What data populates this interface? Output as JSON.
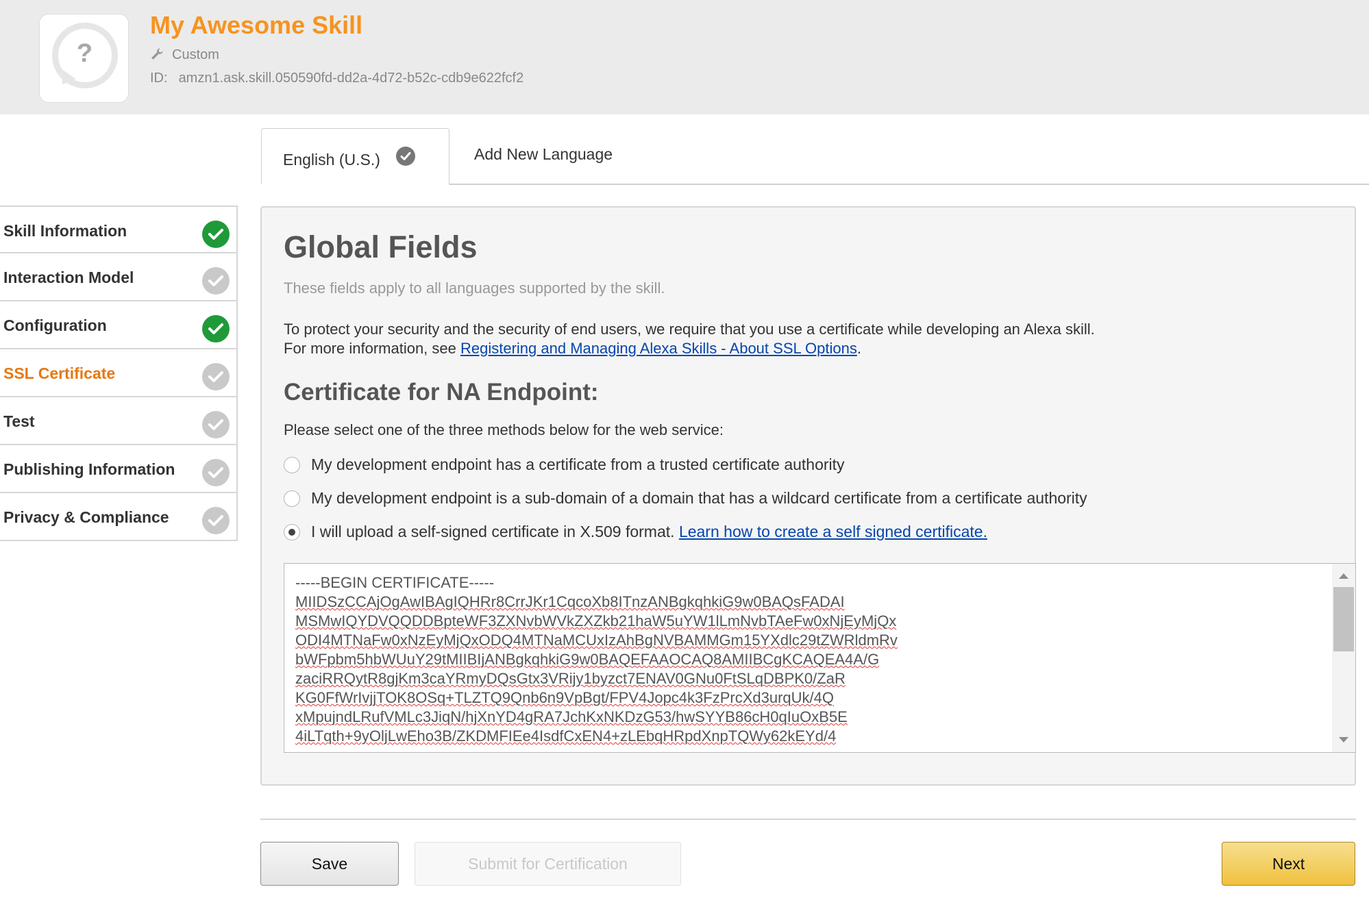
{
  "header": {
    "skill_name": "My Awesome Skill",
    "skill_type": "Custom",
    "id_label": "ID:",
    "skill_id": "amzn1.ask.skill.050590fd-dd2a-4d72-b52c-cdb9e622fcf2",
    "icon_glyph": "?"
  },
  "language_tabs": {
    "active": "English (U.S.)",
    "add_label": "Add New Language"
  },
  "sidebar": {
    "items": [
      {
        "label": "Skill Information",
        "status": "complete"
      },
      {
        "label": "Interaction Model",
        "status": "incomplete"
      },
      {
        "label": "Configuration",
        "status": "complete"
      },
      {
        "label": "SSL Certificate",
        "status": "incomplete",
        "active": true
      },
      {
        "label": "Test",
        "status": "incomplete"
      },
      {
        "label": "Publishing Information",
        "status": "incomplete"
      },
      {
        "label": "Privacy & Compliance",
        "status": "incomplete"
      }
    ]
  },
  "main": {
    "title": "Global Fields",
    "subtitle": "These fields apply to all languages supported by the skill.",
    "info_line1": "To protect your security and the security of end users, we require that you use a certificate while developing an Alexa skill.",
    "info_line2_prefix": "For more information, see ",
    "info_link": "Registering and Managing Alexa Skills - About SSL Options",
    "info_line2_suffix": ".",
    "cert_heading": "Certificate for NA Endpoint:",
    "cert_prompt": "Please select one of the three methods below for the web service:",
    "options": [
      {
        "label": "My development endpoint has a certificate from a trusted certificate authority",
        "selected": false
      },
      {
        "label": "My development endpoint is a sub-domain of a domain that has a wildcard certificate from a certificate authority",
        "selected": false
      },
      {
        "label": "I will upload a self-signed certificate in X.509 format. ",
        "link": "Learn how to create a self signed certificate.",
        "selected": true
      }
    ],
    "certificate_lines": [
      "-----BEGIN CERTIFICATE-----",
      "MIIDSzCCAjOgAwIBAgIQHRr8CrrJKr1CqcoXb8ITnzANBgkqhkiG9w0BAQsFADAI",
      "MSMwIQYDVQQDDBpteWF3ZXNvbWVkZXZkb21haW5uYW1lLmNvbTAeFw0xNjEyMjQx",
      "ODI4MTNaFw0xNzEyMjQxODQ4MTNaMCUxIzAhBgNVBAMMGm15YXdlc29tZWRldmRv",
      "bWFpbm5hbWUuY29tMIIBIjANBgkqhkiG9w0BAQEFAAOCAQ8AMIIBCgKCAQEA4A/G",
      "zaciRRQytR8gjKm3caYRmyDQsGtx3VRijy1byzct7ENAV0GNu0FtSLqDBPK0/ZaR",
      "KG0FfWrIvjjTOK8OSq+TLZTQ9Qnb6n9VpBgt/FPV4Jopc4k3FzPrcXd3urqUk/4Q",
      "xMpujndLRufVMLc3JiqN/hjXnYD4gRA7JchKxNKDzG53/hwSYYB86cH0qIuOxB5E",
      "4iLTqth+9yOljLwEho3B/ZKDMFIEe4IsdfCxEN4+zLEbqHRpdXnpTQWy62kEYd/4"
    ]
  },
  "buttons": {
    "save": "Save",
    "submit": "Submit for Certification",
    "next": "Next"
  },
  "colors": {
    "accent_orange": "#f7931e",
    "active_nav": "#e47911",
    "complete_green": "#1f9a38",
    "incomplete_gray": "#c9c9c9",
    "link_blue": "#0645ad",
    "next_button": "#f0c13f"
  }
}
